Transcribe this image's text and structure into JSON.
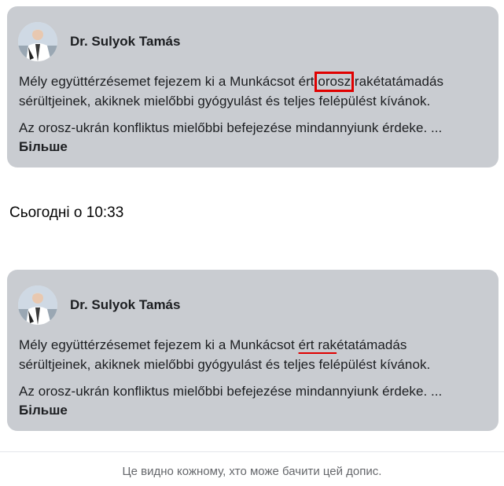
{
  "posts": [
    {
      "author": "Dr. Sulyok Tamás",
      "line1_pre": "Mély együttérzésemet fejezem ki a Munkácsot ért ",
      "line1_highlight": "orosz",
      "line1_post": " rakétatámadás",
      "line2": "sérültjeinek, akiknek mielőbbi gyógyulást és teljes felépülést kívánok.",
      "line3": "Az orosz-ukrán konfliktus mielőbbi befejezése mindannyiunk érdeke. ...",
      "more": "Більше"
    },
    {
      "author": "Dr. Sulyok Tamás",
      "line1_pre": "Mély együttérzésemet fejezem ki a Munkácsot ",
      "line1_highlight": "ért rak",
      "line1_post": "étatámadás",
      "line2": "sérültjeinek, akiknek mielőbbi gyógyulást és teljes felépülést kívánok.",
      "line3": "Az orosz-ukrán konfliktus mielőbbi befejezése mindannyiunk érdeke. ...",
      "more": "Більше"
    }
  ],
  "timestamp": "Сьогодні о 10:33",
  "footer": "Це видно кожному, хто може бачити цей допис.",
  "colors": {
    "card_background": "#c9ccd1",
    "highlight": "#e00000",
    "footer_text": "#65676b"
  }
}
